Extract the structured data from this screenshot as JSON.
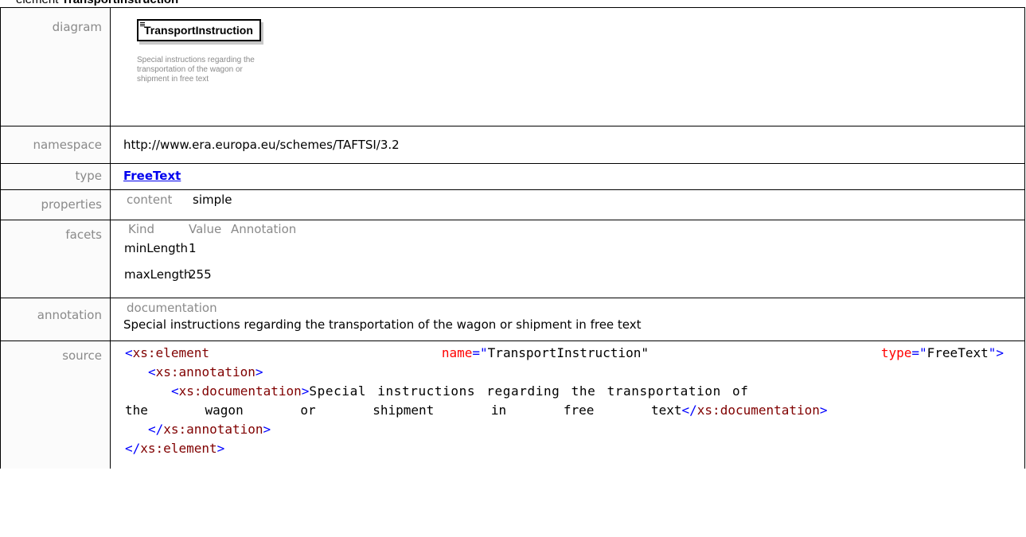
{
  "heading": {
    "kind": "element",
    "name": "TransportInstruction"
  },
  "rows": {
    "diagram": {
      "label": "diagram",
      "box_name": "TransportInstruction",
      "doc_text": "Special instructions regarding the transportation of the wagon or shipment in free text"
    },
    "namespace": {
      "label": "namespace",
      "value": "http://www.era.europa.eu/schemes/TAFTSI/3.2"
    },
    "type": {
      "label": "type",
      "value": "FreeText"
    },
    "properties": {
      "label": "properties",
      "key": "content",
      "value": "simple"
    },
    "facets": {
      "label": "facets",
      "headers": [
        "Kind",
        "Value",
        "Annotation"
      ],
      "items": [
        {
          "kind": "minLength",
          "value": "1"
        },
        {
          "kind": "maxLength",
          "value": "255"
        }
      ]
    },
    "annotation": {
      "label": "annotation",
      "key": "documentation",
      "text": "Special instructions regarding the transportation of the wagon or shipment in free text"
    },
    "source": {
      "label": "source",
      "lines": [
        [
          "<",
          "xs:",
          "element",
          "name",
          "=\"",
          "TransportInstruction",
          "\"",
          "type",
          "=\"",
          "FreeText",
          "\">"
        ],
        [
          "<",
          "xs:",
          "annotation",
          ">"
        ],
        [
          "<",
          "xs:",
          "documentation",
          ">",
          "Special instructions regarding the transportation of"
        ],
        [
          "the wagon or shipment in free text",
          "</",
          "xs:",
          "documentation",
          ">"
        ],
        [
          "</",
          "xs:",
          "annotation",
          ">"
        ],
        [
          "</",
          "xs:",
          "element",
          ">"
        ]
      ]
    }
  },
  "colors": {
    "label_grey": "#8a8a8a",
    "link_blue": "#0000ee",
    "tag_maroon": "#800000",
    "ns_blue": "#0000ff",
    "attr_red": "#ff0000"
  }
}
